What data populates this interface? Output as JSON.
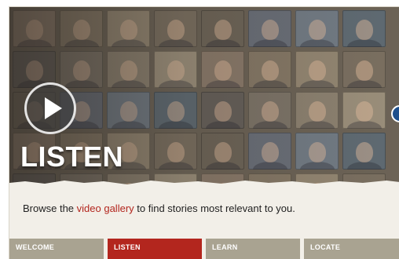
{
  "hero": {
    "title": "LISTEN",
    "play_icon": "play-icon",
    "next_icon": "circle-arrow-icon"
  },
  "description": {
    "before": "Browse the ",
    "link": "video gallery",
    "after": " to find stories most relevant to you."
  },
  "tabs": [
    {
      "label": "WELCOME",
      "active": false
    },
    {
      "label": "LISTEN",
      "active": true
    },
    {
      "label": "LEARN",
      "active": false
    },
    {
      "label": "LOCATE",
      "active": false
    }
  ],
  "colors": {
    "accent": "#b3261e",
    "tab_inactive": "#a9a391",
    "background": "#f2efe8",
    "next_button": "#1e4f8c"
  }
}
